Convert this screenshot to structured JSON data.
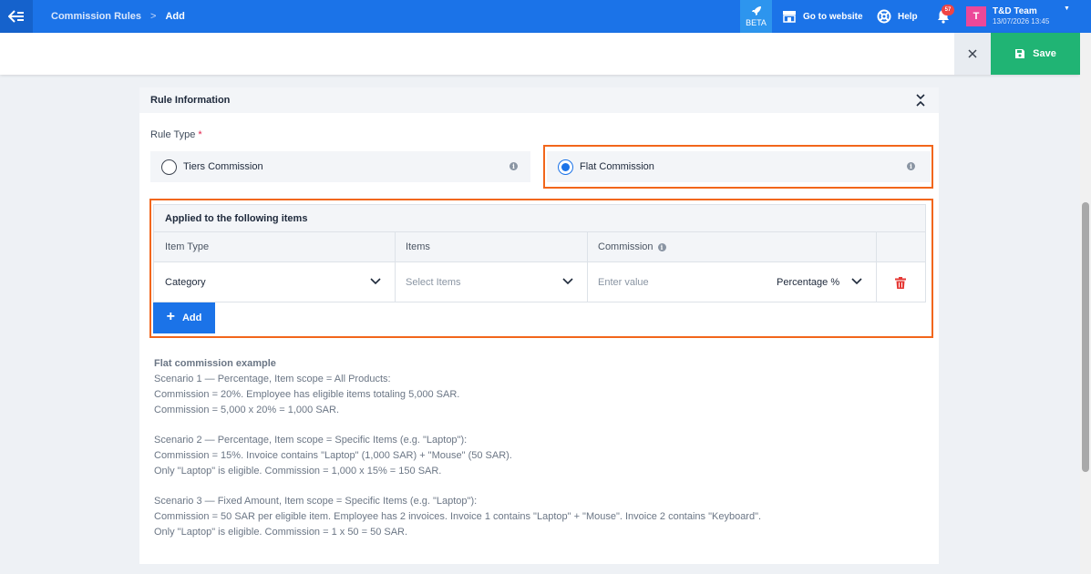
{
  "nav": {
    "breadcrumb_parent": "Commission Rules",
    "breadcrumb_current": "Add",
    "beta_label": "BETA",
    "website_label": "Go to website",
    "help_label": "Help",
    "notification_count": "57",
    "user_initial": "T",
    "user_name": "T&D Team",
    "user_date": "13/07/2026 13:45"
  },
  "actions": {
    "save_label": "Save"
  },
  "card": {
    "title": "Rule Information",
    "rule_type_label": "Rule Type",
    "required_mark": "*",
    "options": [
      {
        "label": "Tiers Commission",
        "selected": false
      },
      {
        "label": "Flat Commission",
        "selected": true
      }
    ],
    "info_glyph": "i"
  },
  "items_table": {
    "title": "Applied to the following items",
    "headers": [
      "Item Type",
      "Items",
      "Commission"
    ],
    "row": {
      "item_type": "Category",
      "items_placeholder": "Select Items",
      "commission_placeholder": "Enter value",
      "commission_unit": "Percentage %"
    },
    "add_label": "Add"
  },
  "example": {
    "title": "Flat commission example",
    "scenario1": [
      "Scenario 1 — Percentage, Item scope = All Products:",
      "Commission = 20%. Employee has eligible items totaling 5,000 SAR.",
      "Commission = 5,000 x 20% = 1,000 SAR."
    ],
    "scenario2": [
      "Scenario 2 — Percentage, Item scope = Specific Items (e.g. \"Laptop\"):",
      "Commission = 15%. Invoice contains \"Laptop\" (1,000 SAR) + \"Mouse\" (50 SAR).",
      "Only \"Laptop\" is eligible. Commission = 1,000 x 15% = 150 SAR."
    ],
    "scenario3": [
      "Scenario 3 — Fixed Amount, Item scope = Specific Items (e.g. \"Laptop\"):",
      "Commission = 50 SAR per eligible item. Employee has 2 invoices. Invoice 1 contains \"Laptop\" + \"Mouse\". Invoice 2 contains \"Keyboard\".",
      "Only \"Laptop\" is eligible. Commission = 1 x 50 = 50 SAR."
    ]
  },
  "colors": {
    "primary": "#1b73e8",
    "save": "#20b474",
    "highlight": "#f2661b",
    "delete": "#e53935"
  }
}
